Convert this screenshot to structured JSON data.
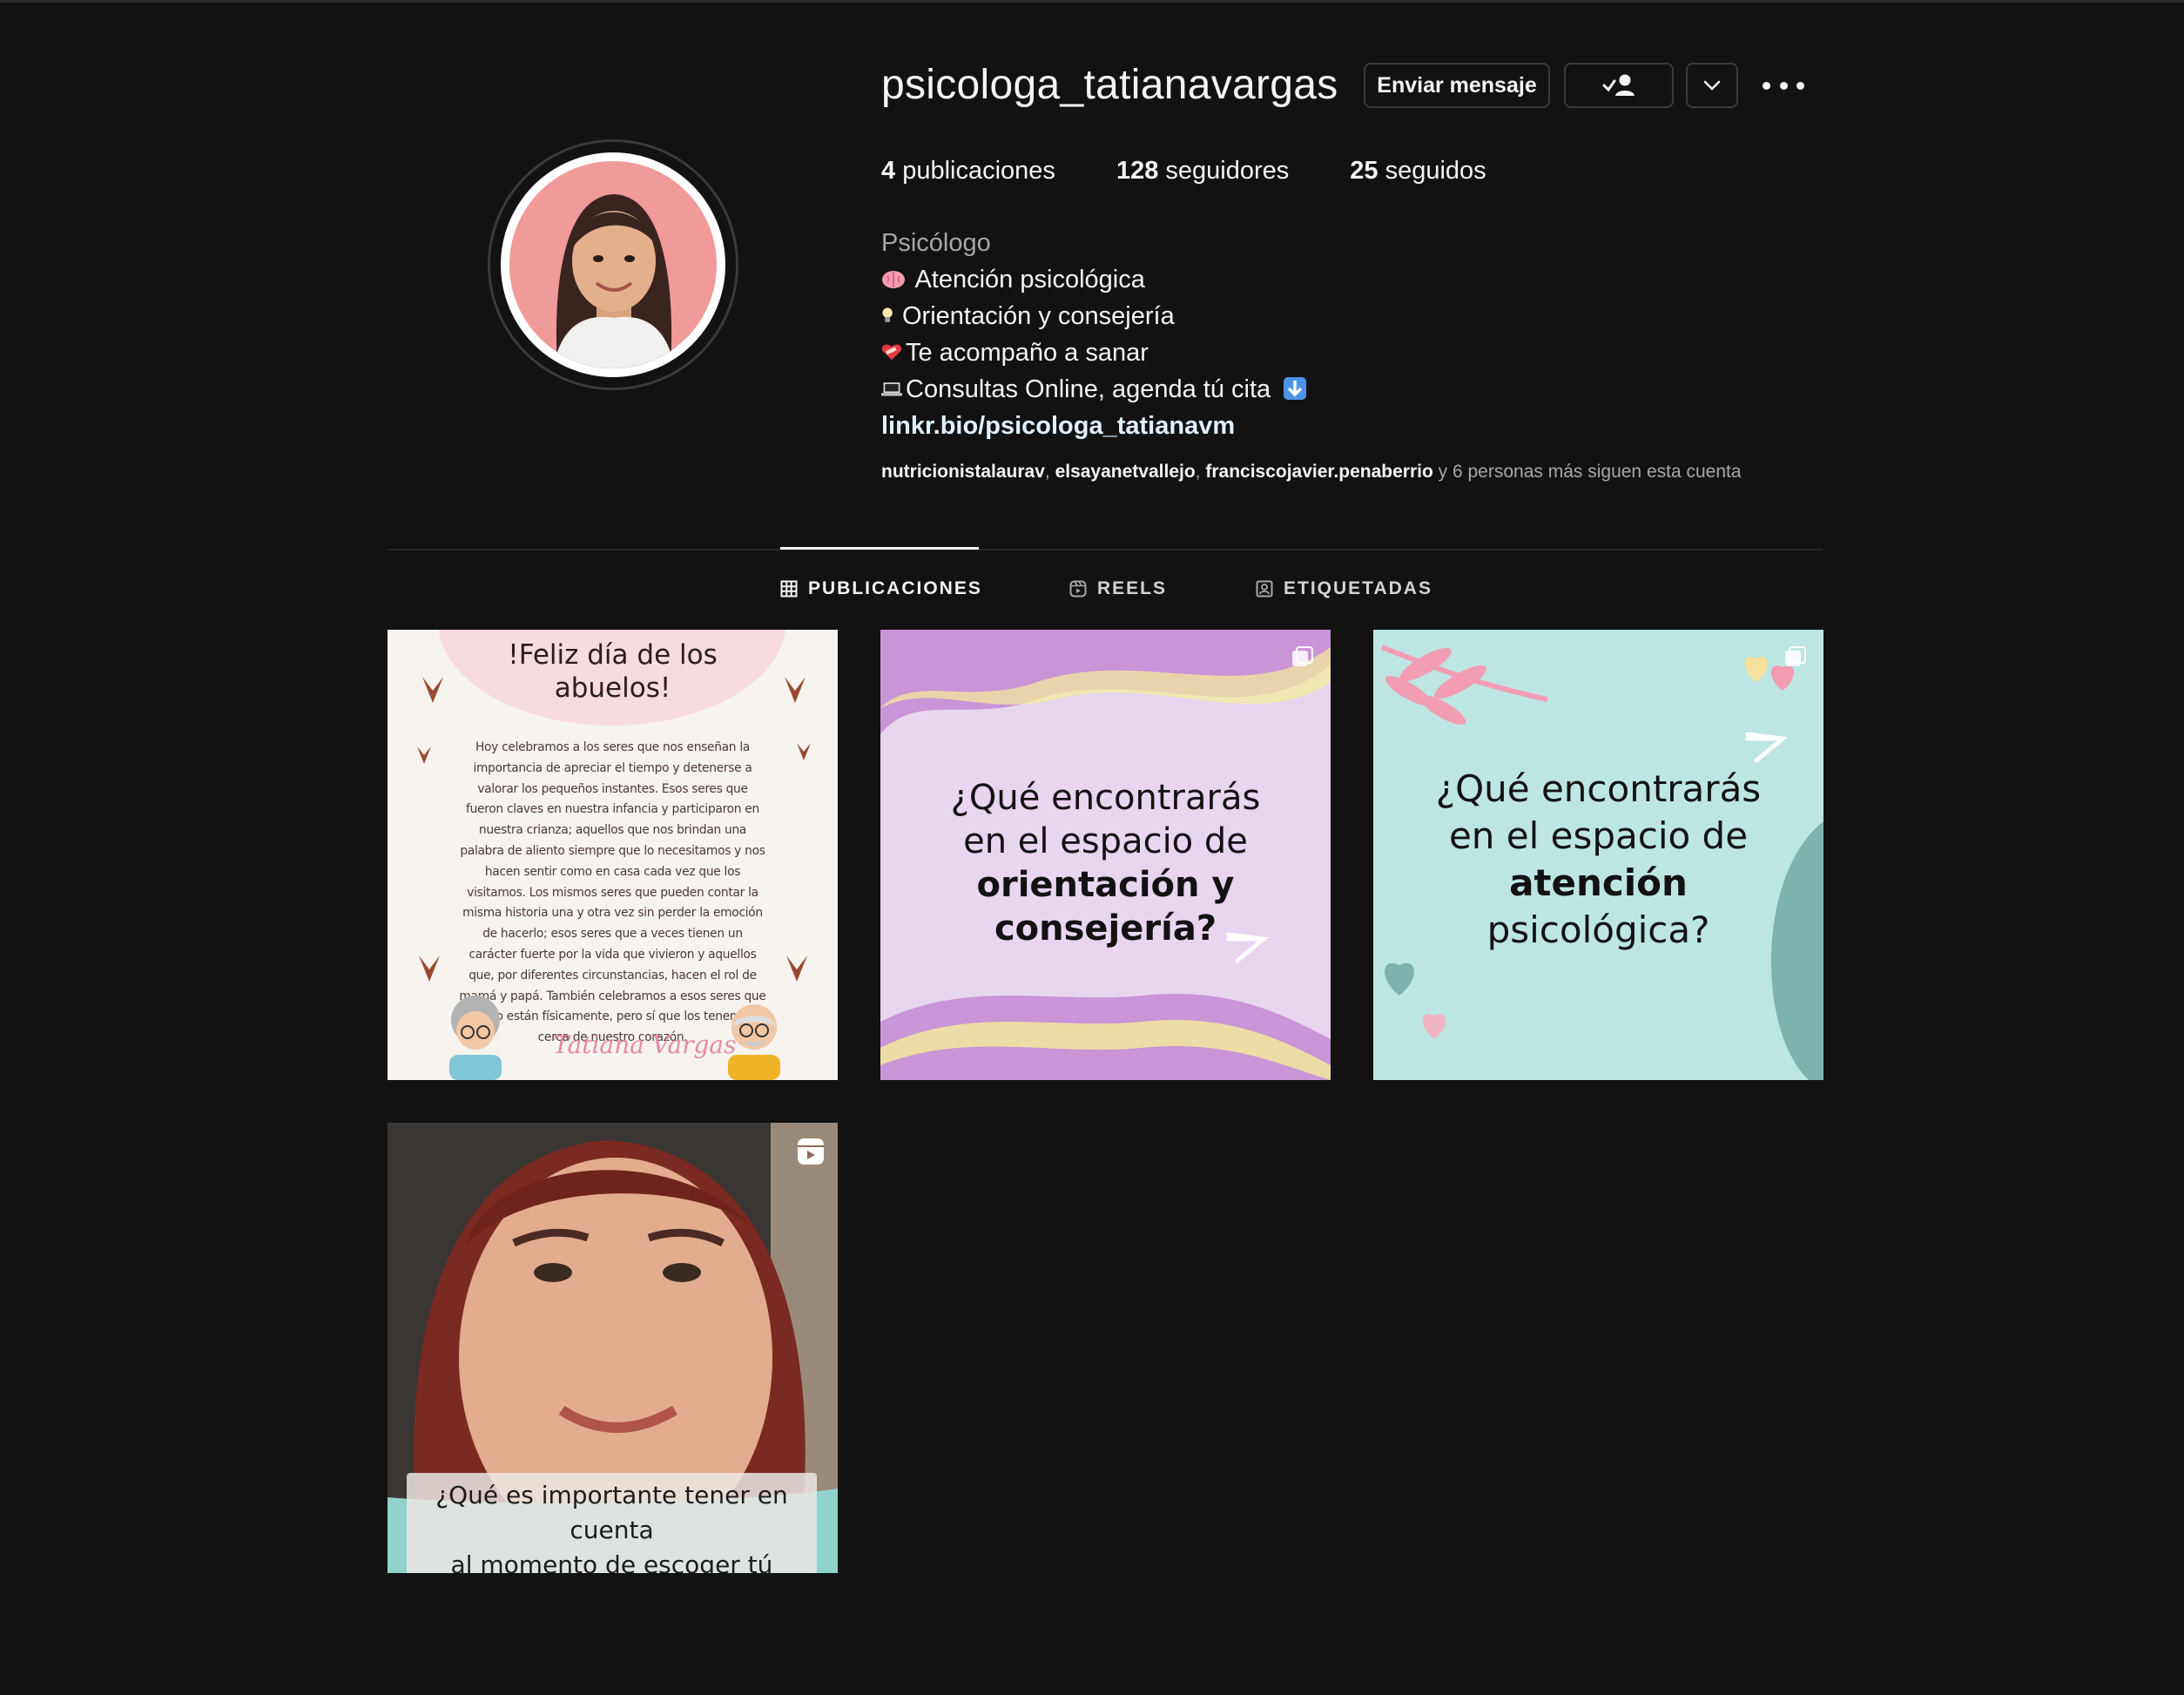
{
  "profile": {
    "username": "psicologa_tatianavargas",
    "buttons": {
      "message": "Enviar mensaje"
    },
    "stats": [
      {
        "count": "4",
        "label": " publicaciones"
      },
      {
        "count": "128",
        "label": " seguidores"
      },
      {
        "count": "25",
        "label": " seguidos"
      }
    ],
    "bio": {
      "category": "Psicólogo",
      "lines": [
        {
          "icon": "brain-emoji",
          "text": " Atención psicológica"
        },
        {
          "icon": "lightbulb-emoji",
          "text": "Orientación y consejería"
        },
        {
          "icon": "bandaged-heart-emoji",
          "text": "Te acompaño a sanar"
        },
        {
          "icon": "laptop-emoji",
          "text": "Consultas Online, agenda tú cita"
        }
      ],
      "trailing_icon": "down-arrow-emoji",
      "link": "linkr.bio/psicologa_tatianavm"
    },
    "followed_by": {
      "names": [
        "nutricionistalaurav",
        "elsayanetvallejo",
        "franciscojavier.penaberrio"
      ],
      "sep": ", ",
      "suffix": " y 6 personas más siguen esta cuenta"
    }
  },
  "tabs": [
    {
      "label": "PUBLICACIONES",
      "icon": "grid-icon",
      "active": true
    },
    {
      "label": "REELS",
      "icon": "reels-icon",
      "active": false
    },
    {
      "label": "ETIQUETADAS",
      "icon": "tagged-icon",
      "active": false
    }
  ],
  "posts": [
    {
      "type": "image",
      "title_line1": "!Feliz día de los",
      "title_line2": "abuelos!",
      "body": "Hoy celebramos a los seres que nos enseñan la importancia de apreciar el tiempo y detenerse a valorar los pequeños instantes. Esos seres que fueron claves en nuestra infancia y participaron en nuestra crianza; aquellos que nos brindan una palabra de aliento siempre que lo necesitamos y nos hacen sentir como en casa cada vez que los visitamos. Los mismos seres que pueden contar la misma historia una y otra vez sin perder la emoción de hacerlo; esos seres que a veces tienen un carácter fuerte por la vida que vivieron y aquellos que, por diferentes circunstancias, hacen el rol de mamá y papá. También celebramos a esos seres que ya no están físicamente, pero sí que los tenemos cerca de nuestro corazón.",
      "signature": "Tatiana Vargas"
    },
    {
      "type": "carousel",
      "line1": "¿Qué encontrarás",
      "line2": "en el espacio de",
      "line3": "orientación y consejería?"
    },
    {
      "type": "carousel",
      "line1": "¿Qué encontrarás",
      "line2": "en el espacio de",
      "line3": "atención",
      "line4": "psicológica?"
    },
    {
      "type": "reel",
      "caption_line1": "¿Qué es importante tener en cuenta",
      "caption_line2": "al momento de escoger tú psicólogo?"
    }
  ],
  "colors": {
    "background": "#121212",
    "text": "#f5f5f5",
    "muted": "#a8a8a8",
    "link": "#e0f1ff",
    "avatar_bg": "#f19a9a"
  }
}
